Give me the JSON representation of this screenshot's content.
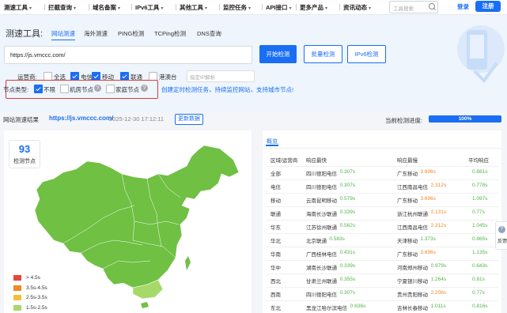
{
  "nav": {
    "items": [
      "测速工具",
      "拦截查询",
      "域名备案",
      "IPv6工具",
      "其他工具",
      "监控任务",
      "API接口",
      "更多产品",
      "资讯动态"
    ],
    "search_placeholder": "工具搜索",
    "login": "登录",
    "register": "注册"
  },
  "panel": {
    "title": "测速工具:",
    "tabs": [
      "网站测速",
      "海外测速",
      "PING检测",
      "TCPing检测",
      "DNS查询"
    ],
    "url_value": "https://js.vmccc.com/",
    "btn_start": "开始检测",
    "btn_batch": "批量检测",
    "btn_ipv6": "IPv6检测",
    "operator_label": "运营商:",
    "operators": [
      {
        "label": "全选",
        "checked": false
      },
      {
        "label": "电信",
        "checked": true
      },
      {
        "label": "移动",
        "checked": true
      },
      {
        "label": "联通",
        "checked": true
      },
      {
        "label": "港澳台",
        "checked": false
      }
    ],
    "ip_placeholder": "指定IP解析",
    "node_type_label": "节点类型:",
    "node_types": [
      {
        "label": "不限",
        "checked": true
      },
      {
        "label": "机房节点",
        "checked": false
      },
      {
        "label": "家庭节点",
        "checked": false
      }
    ],
    "promo": "创建定时检测任务，持续监控网站，支持城市节点!"
  },
  "result": {
    "label": "网站测速结果",
    "url": "https://js.vmccc.com/",
    "time": "2025-12-30 17:12:11",
    "refresh": "更新数据",
    "progress_label": "当前检测进度:",
    "progress_text": "100%",
    "progress": 1.0
  },
  "map": {
    "node_count": "93",
    "node_label": "检测节点",
    "legend": [
      {
        "label": "> 4.5s",
        "color": "#e8473c"
      },
      {
        "label": "3.5s-4.5s",
        "color": "#f08a24"
      },
      {
        "label": "2.5s-3.5s",
        "color": "#f2c037"
      },
      {
        "label": "1.5s-2.5s",
        "color": "#a6d96a"
      }
    ],
    "fill": "#6fc043"
  },
  "table": {
    "tab": "概览",
    "headers": [
      "区域/运营商",
      "响应最快",
      "响应最慢",
      "平均响应"
    ],
    "rows": [
      {
        "region": "全部",
        "fast": "四川德阳电信",
        "fast_t": "0.307s",
        "slow": "广东移动",
        "slow_t": "3.696s",
        "slow_c": "o",
        "avg": "0.881s"
      },
      {
        "region": "电信",
        "fast": "四川德阳电信",
        "fast_t": "0.307s",
        "slow": "江西南昌电信",
        "slow_t": "2.312s",
        "slow_c": "o",
        "avg": "0.778s"
      },
      {
        "region": "移动",
        "fast": "云南昆明移动",
        "fast_t": "0.579s",
        "slow": "广东移动",
        "slow_t": "3.696s",
        "slow_c": "o",
        "avg": "1.097s"
      },
      {
        "region": "联通",
        "fast": "海南长沙联通",
        "fast_t": "0.339s",
        "slow": "浙江杭州联通",
        "slow_t": "2.131s",
        "slow_c": "o",
        "avg": "0.77s"
      },
      {
        "region": "华东",
        "fast": "江苏徐州联通",
        "fast_t": "0.562s",
        "slow": "江西南昌电信",
        "slow_t": "2.312s",
        "slow_c": "o",
        "avg": "1.045s"
      },
      {
        "region": "华北",
        "fast": "北京联通",
        "fast_t": "0.583s",
        "slow": "天津移动",
        "slow_t": "1.373s",
        "slow_c": "g",
        "avg": "0.865s"
      },
      {
        "region": "华南",
        "fast": "广西桂林电信",
        "fast_t": "0.431s",
        "slow": "广东移动",
        "slow_t": "3.696s",
        "slow_c": "o",
        "avg": "1.135s"
      },
      {
        "region": "华中",
        "fast": "湖南长沙联通",
        "fast_t": "0.339s",
        "slow": "河南郑州移动",
        "slow_t": "0.979s",
        "slow_c": "g",
        "avg": "0.643s"
      },
      {
        "region": "西北",
        "fast": "甘肃兰州联通",
        "fast_t": "0.355s",
        "slow": "宁夏银川移动",
        "slow_t": "1.264s",
        "slow_c": "g",
        "avg": "0.81s"
      },
      {
        "region": "西南",
        "fast": "四川德阳电信",
        "fast_t": "0.307s",
        "slow": "贵州贵阳移动",
        "slow_t": "2.206s",
        "slow_c": "o",
        "avg": "0.77s"
      },
      {
        "region": "东北",
        "fast": "黑龙江哈尔滨电信",
        "fast_t": "0.636s",
        "slow": "吉林长春移动",
        "slow_t": "1.011s",
        "slow_c": "g",
        "avg": "0.816s"
      }
    ]
  },
  "side": {
    "label": "反馈"
  }
}
